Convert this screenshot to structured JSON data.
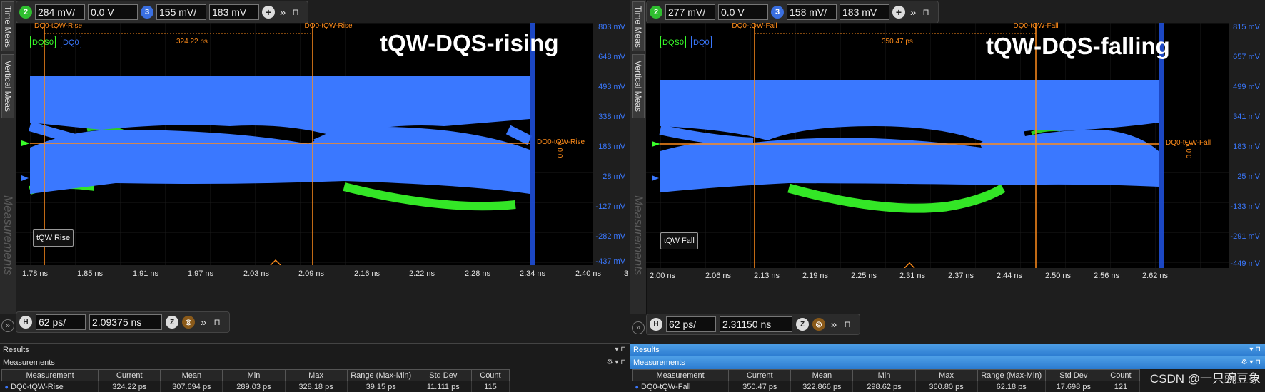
{
  "panels": [
    {
      "side_tabs": [
        "Time Meas",
        "Vertical Meas",
        "Measurements"
      ],
      "toolbar": {
        "chan_a_num": "2",
        "chan_a_color": "#2fbf2f",
        "scale_a": "284 mV/",
        "offset_a": "0.0 V",
        "chan_b_num": "3",
        "chan_b_color": "#3a6fe0",
        "scale_b": "155 mV/",
        "offset_b": "183 mV"
      },
      "overlay_title": "tQW-DQS-rising",
      "chan_tags": [
        "DQS0",
        "DQ0"
      ],
      "marker_a_label": "DQ0-tQW-Rise",
      "marker_b_label": "DQ0-tQW-Rise",
      "delta_label": "324.22 ps",
      "trigger_label": "DQ0-tQW-Rise",
      "trigger_vert": "0.0 V",
      "box_label": "tQW Rise",
      "y_ticks": [
        "803 mV",
        "648 mV",
        "493 mV",
        "338 mV",
        "183 mV",
        "28 mV",
        "-127 mV",
        "-282 mV",
        "-437 mV"
      ],
      "x_ticks": [
        "1.78 ns",
        "1.85 ns",
        "1.91 ns",
        "1.97 ns",
        "2.03 ns",
        "2.09 ns",
        "2.16 ns",
        "2.22 ns",
        "2.28 ns",
        "2.34 ns",
        "2.40 ns"
      ],
      "x_tail": "3",
      "timebase": {
        "h": "H",
        "scale": "62 ps/",
        "position": "2.09375 ns"
      },
      "results": {
        "title": "Results",
        "subtitle": "Measurements",
        "columns": [
          "Measurement",
          "Current",
          "Mean",
          "Min",
          "Max",
          "Range (Max-Min)",
          "Std Dev",
          "Count"
        ],
        "row": [
          "DQ0-tQW-Rise",
          "324.22 ps",
          "307.694 ps",
          "289.03 ps",
          "328.18 ps",
          "39.15 ps",
          "11.111 ps",
          "115"
        ]
      }
    },
    {
      "side_tabs": [
        "Time Meas",
        "Vertical Meas",
        "Measurements"
      ],
      "toolbar": {
        "chan_a_num": "2",
        "chan_a_color": "#2fbf2f",
        "scale_a": "277 mV/",
        "offset_a": "0.0 V",
        "chan_b_num": "3",
        "chan_b_color": "#3a6fe0",
        "scale_b": "158 mV/",
        "offset_b": "183 mV"
      },
      "overlay_title": "tQW-DQS-falling",
      "chan_tags": [
        "DQS0",
        "DQ0"
      ],
      "marker_a_label": "DQ0-tQW-Fall",
      "marker_b_label": "DQ0-tQW-Fall",
      "delta_label": "350.47 ps",
      "trigger_label": "DQ0-tQW-Fall",
      "trigger_vert": "0.0 V",
      "box_label": "tQW Fall",
      "y_ticks": [
        "815 mV",
        "657 mV",
        "499 mV",
        "341 mV",
        "183 mV",
        "25 mV",
        "-133 mV",
        "-291 mV",
        "-449 mV"
      ],
      "x_ticks": [
        "2.00 ns",
        "2.06 ns",
        "2.13 ns",
        "2.19 ns",
        "2.25 ns",
        "2.31 ns",
        "2.37 ns",
        "2.44 ns",
        "2.50 ns",
        "2.56 ns",
        "2.62 ns"
      ],
      "x_tail": "",
      "timebase": {
        "h": "H",
        "scale": "62 ps/",
        "position": "2.31150 ns"
      },
      "results": {
        "title": "Results",
        "subtitle": "Measurements",
        "columns": [
          "Measurement",
          "Current",
          "Mean",
          "Min",
          "Max",
          "Range (Max-Min)",
          "Std Dev",
          "Count"
        ],
        "row": [
          "DQ0-tQW-Fall",
          "350.47 ps",
          "322.866 ps",
          "298.62 ps",
          "360.80 ps",
          "62.18 ps",
          "17.698 ps",
          "121"
        ]
      }
    }
  ],
  "watermark": "CSDN @一只豌豆象",
  "colors": {
    "dq_blue": "#3a78ff",
    "dqs_green": "#39ff2a",
    "cursor_orange": "#ff8c1a",
    "axis_blue": "#1f4fd8"
  }
}
